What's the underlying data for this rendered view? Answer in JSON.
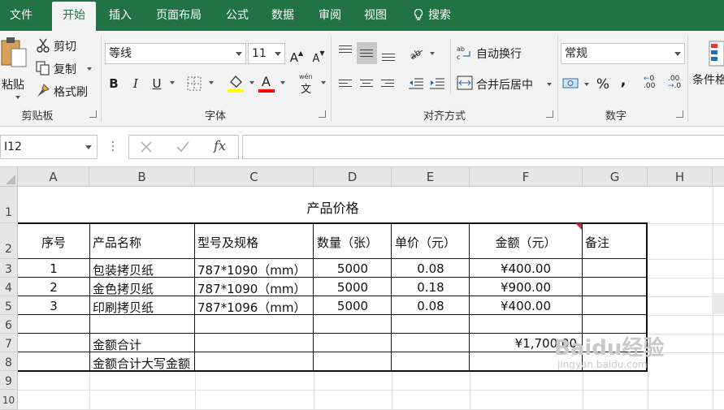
{
  "tabs": [
    "文件",
    "开始",
    "插入",
    "页面布局",
    "公式",
    "数据",
    "审阅",
    "视图"
  ],
  "search_label": "搜索",
  "clipboard": {
    "paste": "粘贴",
    "cut": "剪切",
    "copy": "复制",
    "format_painter": "格式刷",
    "group": "剪贴板"
  },
  "font": {
    "name": "等线",
    "size": "11",
    "bold": "B",
    "italic": "I",
    "underline": "U",
    "font_color_letter": "A",
    "phonetic_top": "wén",
    "phonetic_char": "文",
    "group": "字体",
    "grow": "A",
    "shrink": "A"
  },
  "alignment": {
    "wrap_text": "自动换行",
    "merge_center": "合并后居中",
    "group": "对齐方式"
  },
  "number": {
    "format": "常规",
    "percent": "%",
    "comma": ",",
    "inc_decimal": ".00",
    "dec_decimal": ".00",
    "group": "数字"
  },
  "styles": {
    "conditional": "条件格"
  },
  "formula_bar": {
    "name_box": "I12",
    "fx": "fx"
  },
  "columns": [
    "A",
    "B",
    "C",
    "D",
    "E",
    "F",
    "G",
    "H"
  ],
  "rows": [
    "1",
    "2",
    "3",
    "4",
    "5",
    "6",
    "7",
    "8",
    "9",
    "10"
  ],
  "sheet": {
    "title": "产品价格",
    "headers": [
      "序号",
      "产品名称",
      "型号及规格",
      "数量（张）",
      "单价（元）",
      "金额（元）",
      "备注"
    ],
    "items": [
      [
        "1",
        "包装拷贝纸",
        "787*1090（mm）",
        "5000",
        "0.08",
        "¥400.00",
        ""
      ],
      [
        "2",
        "金色拷贝纸",
        "787*1090（mm）",
        "5000",
        "0.18",
        "¥900.00",
        ""
      ],
      [
        "3",
        "印刷拷贝纸",
        "787*1096（mm）",
        "5000",
        "0.08",
        "¥400.00",
        ""
      ]
    ],
    "total_label": "金额合计",
    "total_value": "¥1,700.00",
    "total_upper_label": "金额合计大写金额"
  },
  "watermark": {
    "text": "Baidu经验",
    "sub": "jingyan.baidu.com"
  }
}
